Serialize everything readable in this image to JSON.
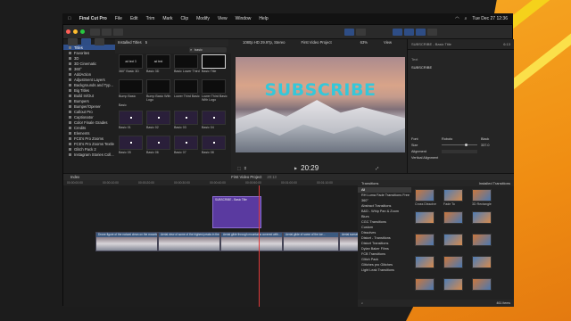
{
  "menubar": {
    "app": "Final Cut Pro",
    "items": [
      "File",
      "Edit",
      "Trim",
      "Mark",
      "Clip",
      "Modify",
      "View",
      "Window",
      "Help"
    ],
    "clock": "Tue Dec 27  12:36"
  },
  "toolbar": {
    "library": "Installed Titles",
    "count": "5"
  },
  "browser_header": {
    "search": "basic"
  },
  "sidebar": {
    "items": [
      "Titles",
      "Favorites",
      "3D",
      "3D Cinematic",
      "360°",
      "AddAction",
      "Adjustment Layers",
      "Backgrounds and Typ...",
      "Big Titles",
      "Build In/Out",
      "Bumpers",
      "Bumper/Opener",
      "Callout Pro",
      "Captionator",
      "Color Finale Grades",
      "Credits",
      "Elements",
      "FCE's Pro Zooms",
      "FCE's Pro Zooms Textle",
      "Glitch Pack 2",
      "Instagram Stories Coll..."
    ]
  },
  "titles_grid": [
    {
      "label": "360° Basic 3D",
      "thumb": "ad text 3"
    },
    {
      "label": "Basic 3D",
      "thumb": "ad text"
    },
    {
      "label": "Basic Lower Third",
      "thumb": ""
    },
    {
      "label": "Basic Title",
      "thumb": ""
    },
    {
      "label": "Bump Basic",
      "thumb": ""
    },
    {
      "label": "Bump Basic With Logo",
      "thumb": ""
    },
    {
      "label": "Lower Third Basic",
      "thumb": ""
    },
    {
      "label": "Lower Third Basic With Logo",
      "thumb": ""
    }
  ],
  "section_basic": "Basic",
  "basic_grid": [
    "Basic 01",
    "Basic 02",
    "Basic 03",
    "Basic 04",
    "Basic 05",
    "Basic 06",
    "Basic 07",
    "Basic 08"
  ],
  "viewer": {
    "format": "1080p HD 29.97p, Stereo",
    "project": "First Video Project",
    "zoom": "63%",
    "view": "View",
    "overlay_text": "SUBSCRIBE",
    "timecode": "20:29"
  },
  "inspector": {
    "title": "SUBSCRIBE - Basic Title",
    "duration": "6:13",
    "section_text": "Text",
    "text_value": "SUBSCRIBE",
    "font_label": "Font",
    "font_value": "Roboto",
    "font_weight": "Black",
    "size_label": "Size",
    "size_value": "337.0",
    "alignment_label": "Alignment",
    "valign_label": "Vertical Alignment"
  },
  "timeline": {
    "index": "Index",
    "project": "First Video Project",
    "duration": "20:13",
    "title_clip": "SUBSCRIBE - Basic Title",
    "clips": [
      "Drone figure of the natural clean on the mountains...",
      "Aerial view of some of the highest peaks in the...",
      "Aerial glide through mountains covered with...",
      "Aerial glide of some of the ice...",
      "Aerial sunset over..."
    ],
    "ruler": [
      "00:00:00:00",
      "00:00:10:00",
      "00:00:20:00",
      "00:00:30:00",
      "00:00:40:00",
      "00:00:50:00",
      "00:01:00:00",
      "00:01:10:00"
    ]
  },
  "transitions": {
    "header": "Transitions",
    "installed": "Installed Transitions",
    "items": [
      "All",
      "RH Luma Fade Transitions Free",
      "360°",
      "Abstract Transitions",
      "B&D - Whip Pan & Zoom",
      "Blurs",
      "CGC Transitions",
      "Custom",
      "Dissolves",
      "Distort - Transitions",
      "Distort Transitions",
      "Dylan Baker Films",
      "FCB Transitions",
      "Glitch Pack",
      "Glitches pro Glitches",
      "Light Leak Transitions"
    ],
    "thumb_labels": [
      "Cross Dissolve",
      "Fade To",
      "3D Rectangle"
    ],
    "count": "461 items"
  }
}
